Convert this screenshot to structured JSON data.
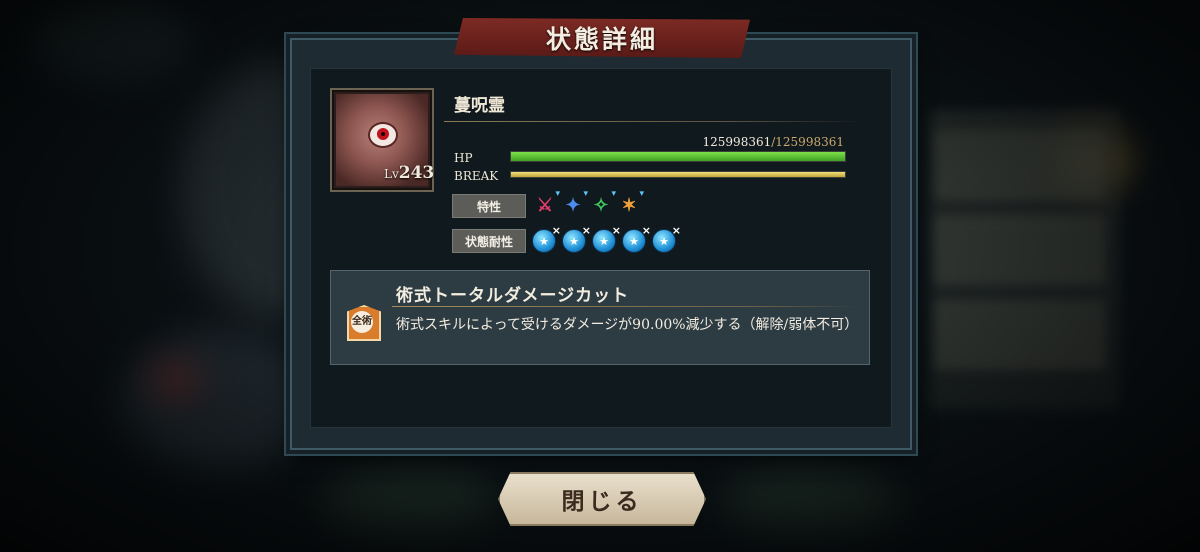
{
  "title": "状態詳細",
  "enemy": {
    "name": "蔓呪霊",
    "level_prefix": "Lv",
    "level": "243",
    "hp_label": "HP",
    "break_label": "BREAK",
    "hp_current": "125998361",
    "hp_max": "/125998361",
    "hp_fraction": 1.0,
    "break_fraction": 1.0
  },
  "traits": {
    "label": "特性",
    "icons": [
      {
        "name": "trait-red-icon",
        "glyph": "⚔",
        "color": "#e23d6a"
      },
      {
        "name": "trait-blue-icon",
        "glyph": "✦",
        "color": "#4a8cf0"
      },
      {
        "name": "trait-green-icon",
        "glyph": "✧",
        "color": "#3fcc62"
      },
      {
        "name": "trait-orange-icon",
        "glyph": "✶",
        "color": "#f0a23a"
      }
    ]
  },
  "resist": {
    "label": "状態耐性",
    "icons": [
      "status-resist-icon",
      "status-resist-icon",
      "status-resist-icon",
      "status-resist-icon",
      "status-resist-icon"
    ],
    "mark": "×"
  },
  "effect": {
    "icon_text": "全",
    "icon_sub": "術",
    "title": "術式トータルダメージカット",
    "description": "術式スキルによって受けるダメージが90.00%減少する（解除/弱体不可）"
  },
  "close_button": "閉じる"
}
